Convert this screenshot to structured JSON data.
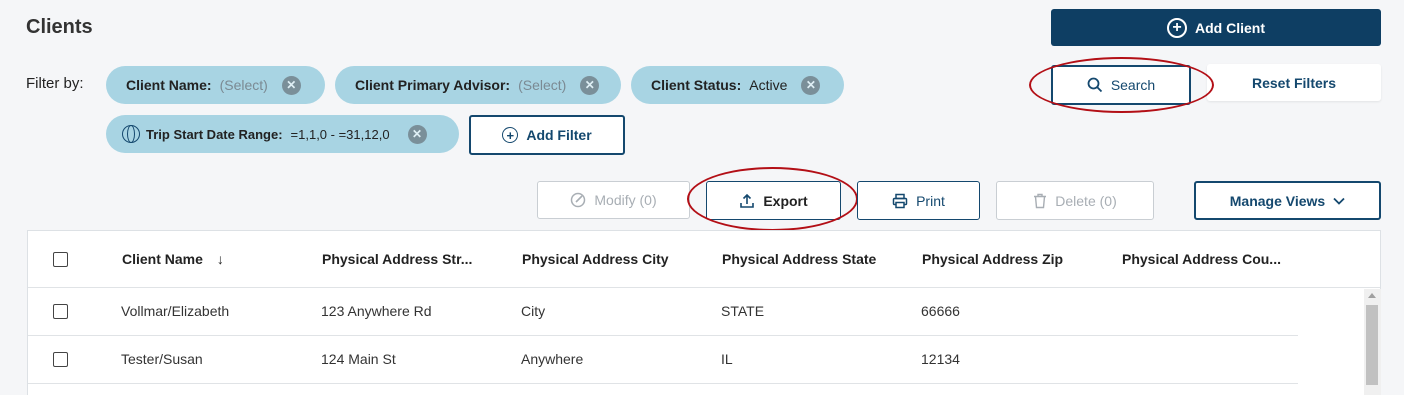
{
  "page": {
    "title": "Clients"
  },
  "actions": {
    "add_client": "Add Client",
    "search": "Search",
    "reset_filters": "Reset Filters"
  },
  "filters": {
    "label": "Filter by:",
    "chips": [
      {
        "key": "Client Name:",
        "value": "(Select)"
      },
      {
        "key": "Client Primary Advisor:",
        "value": "(Select)"
      },
      {
        "key": "Client Status:",
        "value": "Active"
      },
      {
        "key": "Trip Start Date Range:",
        "value": "=1,1,0 - =31,12,0"
      }
    ],
    "add_filter": "Add Filter",
    "remove_symbol": "✕"
  },
  "toolbar": {
    "modify": "Modify (0)",
    "export": "Export",
    "print": "Print",
    "delete": "Delete (0)",
    "manage_views": "Manage Views"
  },
  "table": {
    "columns": [
      "Client Name",
      "Physical Address Str...",
      "Physical Address City",
      "Physical Address State",
      "Physical Address Zip",
      "Physical Address Cou..."
    ],
    "sort_indicator": "↓",
    "rows": [
      [
        "Vollmar/Elizabeth",
        "123 Anywhere Rd",
        "City",
        "STATE",
        "66666",
        ""
      ],
      [
        "Tester/Susan",
        "124 Main St",
        "Anywhere",
        "IL",
        "12134",
        ""
      ]
    ]
  },
  "colors": {
    "primary": "#0e3e63",
    "chip": "#a8d4e3",
    "highlight": "#b30f16"
  }
}
